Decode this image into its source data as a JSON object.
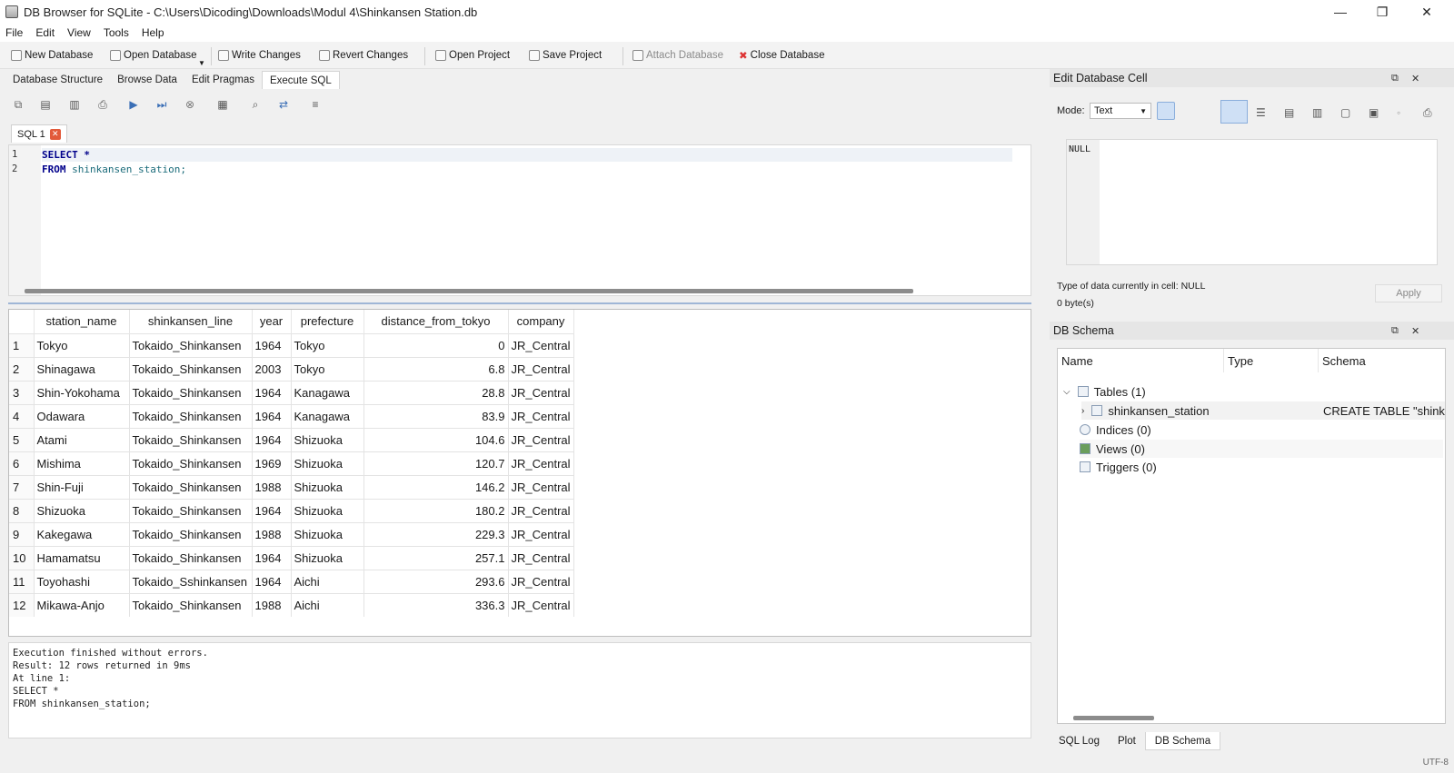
{
  "window": {
    "title": "DB Browser for SQLite - C:\\Users\\Dicoding\\Downloads\\Modul 4\\Shinkansen Station.db",
    "minimize": "—",
    "maximize": "❐",
    "close": "✕"
  },
  "menu": [
    "File",
    "Edit",
    "View",
    "Tools",
    "Help"
  ],
  "toolbar": {
    "new_db": "New Database",
    "open_db": "Open Database",
    "write": "Write Changes",
    "revert": "Revert Changes",
    "open_project": "Open Project",
    "save_project": "Save Project",
    "attach": "Attach Database",
    "close_db": "Close Database"
  },
  "tabs": [
    "Database Structure",
    "Browse Data",
    "Edit Pragmas",
    "Execute SQL"
  ],
  "sql_tab": {
    "label": "SQL 1",
    "close": "✕"
  },
  "editor": {
    "lines": [
      {
        "n": "1",
        "kw": "SELECT",
        "rest": " *"
      },
      {
        "n": "2",
        "kw": "FROM",
        "rest": " shinkansen_station;"
      }
    ]
  },
  "results": {
    "columns": [
      "station_name",
      "shinkansen_line",
      "year",
      "prefecture",
      "distance_from_tokyo",
      "company"
    ],
    "rows": [
      [
        "1",
        "Tokyo",
        "Tokaido_Shinkansen",
        "1964",
        "Tokyo",
        "0",
        "JR_Central"
      ],
      [
        "2",
        "Shinagawa",
        "Tokaido_Shinkansen",
        "2003",
        "Tokyo",
        "6.8",
        "JR_Central"
      ],
      [
        "3",
        "Shin-Yokohama",
        "Tokaido_Shinkansen",
        "1964",
        "Kanagawa",
        "28.8",
        "JR_Central"
      ],
      [
        "4",
        "Odawara",
        "Tokaido_Shinkansen",
        "1964",
        "Kanagawa",
        "83.9",
        "JR_Central"
      ],
      [
        "5",
        "Atami",
        "Tokaido_Shinkansen",
        "1964",
        "Shizuoka",
        "104.6",
        "JR_Central"
      ],
      [
        "6",
        "Mishima",
        "Tokaido_Shinkansen",
        "1969",
        "Shizuoka",
        "120.7",
        "JR_Central"
      ],
      [
        "7",
        "Shin-Fuji",
        "Tokaido_Shinkansen",
        "1988",
        "Shizuoka",
        "146.2",
        "JR_Central"
      ],
      [
        "8",
        "Shizuoka",
        "Tokaido_Shinkansen",
        "1964",
        "Shizuoka",
        "180.2",
        "JR_Central"
      ],
      [
        "9",
        "Kakegawa",
        "Tokaido_Shinkansen",
        "1988",
        "Shizuoka",
        "229.3",
        "JR_Central"
      ],
      [
        "10",
        "Hamamatsu",
        "Tokaido_Shinkansen",
        "1964",
        "Shizuoka",
        "257.1",
        "JR_Central"
      ],
      [
        "11",
        "Toyohashi",
        "Tokaido_Sshinkansen",
        "1964",
        "Aichi",
        "293.6",
        "JR_Central"
      ],
      [
        "12",
        "Mikawa-Anjo",
        "Tokaido_Shinkansen",
        "1988",
        "Aichi",
        "336.3",
        "JR_Central"
      ]
    ]
  },
  "log": "Execution finished without errors.\nResult: 12 rows returned in 9ms\nAt line 1:\nSELECT *\nFROM shinkansen_station;",
  "cell_pane": {
    "title": "Edit Database Cell",
    "mode_label": "Mode:",
    "mode_value": "Text",
    "null_text": "NULL",
    "type_info": "Type of data currently in cell: NULL",
    "size_info": "0 byte(s)",
    "apply": "Apply"
  },
  "schema_pane": {
    "title": "DB Schema",
    "headers": [
      "Name",
      "Type",
      "Schema"
    ],
    "tables": "Tables (1)",
    "table_name": "shinkansen_station",
    "table_schema": "CREATE TABLE \"shink",
    "indices": "Indices (0)",
    "views": "Views (0)",
    "triggers": "Triggers (0)"
  },
  "bottom_tabs": [
    "SQL Log",
    "Plot",
    "DB Schema"
  ],
  "status": "UTF-8"
}
